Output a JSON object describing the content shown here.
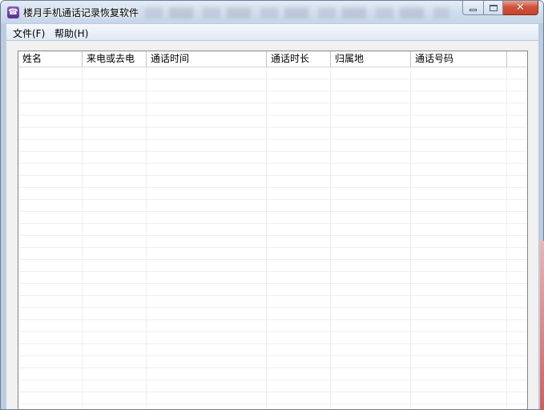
{
  "window": {
    "title": "楼月手机通话记录恢复软件"
  },
  "caption_buttons": {
    "close_glyph": "✕"
  },
  "menu": {
    "items": [
      {
        "label": "文件(F)"
      },
      {
        "label": "帮助(H)"
      }
    ]
  },
  "table": {
    "columns": [
      {
        "label": "姓名"
      },
      {
        "label": "来电或去电"
      },
      {
        "label": "通话时间"
      },
      {
        "label": "通话时长"
      },
      {
        "label": "归属地"
      },
      {
        "label": "通话号码"
      },
      {
        "label": ""
      }
    ],
    "rows": []
  },
  "colors": {
    "accent": "#5a2e91",
    "close_button": "#c7432a",
    "grid_line": "#eeeeee"
  },
  "icons": {
    "app": "phone-icon",
    "minimize": "minimize-icon",
    "maximize": "maximize-icon",
    "close": "close-icon"
  }
}
